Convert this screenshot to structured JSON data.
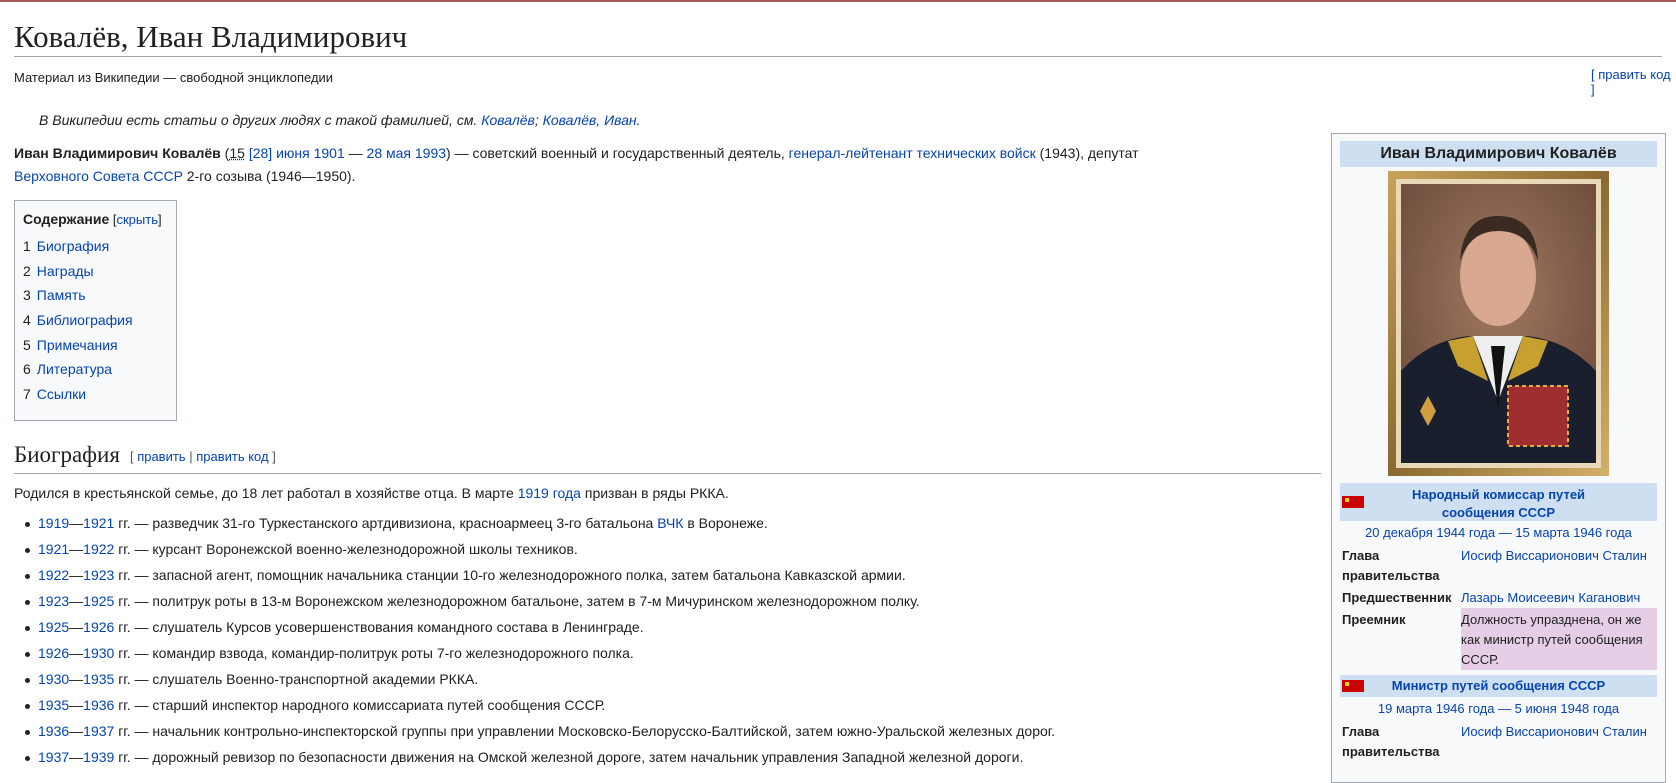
{
  "page": {
    "title": "Ковалёв, Иван Владимирович",
    "tagline": "Материал из Википедии — свободной энциклопедии",
    "edit_code": "[ править код ]"
  },
  "hatnote": {
    "prefix": "В Википедии есть статьи о других людях с такой фамилией, см. ",
    "link1": "Ковалёв",
    "sep1": "; ",
    "link2": "Ковалёв, Иван",
    "suffix": "."
  },
  "lead": {
    "name": "Иван Владимирович Ковалёв",
    "open_paren": " (",
    "birth_day": "15",
    "birth_old": " [28]",
    "birth_date": " июня 1901",
    "dash": " — ",
    "death_date": "28 мая 1993",
    "mid": ") — советский военный и государственный деятель, ",
    "rank": "генерал-лейтенант технических войск",
    "rank_year": " (1943), депутат",
    "soviet": "Верховного Совета СССР",
    "end": " 2-го созыва (1946—1950)."
  },
  "toc": {
    "title": "Содержание",
    "hide": "скрыть",
    "bracket_open": " [",
    "bracket_close": "]",
    "items": [
      {
        "num": "1",
        "label": "Биография"
      },
      {
        "num": "2",
        "label": "Награды"
      },
      {
        "num": "3",
        "label": "Память"
      },
      {
        "num": "4",
        "label": "Библиография"
      },
      {
        "num": "5",
        "label": "Примечания"
      },
      {
        "num": "6",
        "label": "Литература"
      },
      {
        "num": "7",
        "label": "Ссылки"
      }
    ]
  },
  "biography": {
    "heading": "Биография",
    "edit": "править",
    "edit_code": "править код",
    "intro_pre": "Родился в крестьянской семье, до 18 лет работал в хозяйстве отца. В марте ",
    "intro_link": "1919 года",
    "intro_post": " призван в ряды РККА.",
    "items": [
      {
        "y1": "1919",
        "y2": "1921",
        "text": " гг. — разведчик 31-го Туркестанского артдивизиона, красноармеец 3-го батальона ",
        "link": "ВЧК",
        "tail": " в Воронеже."
      },
      {
        "y1": "1921",
        "y2": "1922",
        "text": " гг. — курсант Воронежской военно-железнодорожной школы техников.",
        "link": "",
        "tail": ""
      },
      {
        "y1": "1922",
        "y2": "1923",
        "text": " гг. — запасной агент, помощник начальника станции 10-го железнодорожного полка, затем батальона Кавказской армии.",
        "link": "",
        "tail": ""
      },
      {
        "y1": "1923",
        "y2": "1925",
        "text": " гг. — политрук роты в 13-м Воронежском железнодорожном батальоне, затем в 7-м Мичуринском железнодорожном полку.",
        "link": "",
        "tail": ""
      },
      {
        "y1": "1925",
        "y2": "1926",
        "text": " гг. — слушатель Курсов усовершенствования командного состава в Ленинграде.",
        "link": "",
        "tail": ""
      },
      {
        "y1": "1926",
        "y2": "1930",
        "text": " гг. — командир взвода, командир-политрук роты 7-го железнодорожного полка.",
        "link": "",
        "tail": ""
      },
      {
        "y1": "1930",
        "y2": "1935",
        "text": " гг. — слушатель Военно-транспортной академии РККА.",
        "link": "",
        "tail": ""
      },
      {
        "y1": "1935",
        "y2": "1936",
        "text": " гг. — старший инспектор народного комиссариата путей сообщения СССР.",
        "link": "",
        "tail": ""
      },
      {
        "y1": "1936",
        "y2": "1937",
        "text": " гг. — начальник контрольно-инспекторской группы при управлении Московско-Белорусско-Балтийской, затем южно-Уральской железных дорог.",
        "link": "",
        "tail": ""
      },
      {
        "y1": "1937",
        "y2": "1939",
        "text": " гг. — дорожный ревизор по безопасности движения на Омской железной дороге, затем начальник управления Западной железной дороги.",
        "link": "",
        "tail": ""
      }
    ]
  },
  "infobox": {
    "title": "Иван Владимирович Ковалёв",
    "section1": {
      "title": "Народный комиссар путей сообщения СССР",
      "dates": "20 декабря 1944 года — 15 марта 1946 года",
      "rows": [
        {
          "label": "Глава правительства",
          "value": "Иосиф Виссарионович Сталин",
          "style": "link"
        },
        {
          "label": "Предшественник",
          "value": "Лазарь Моисеевич Каганович",
          "style": "link"
        },
        {
          "label": "Преемник",
          "value": "Должность упразднена, он же как министр путей сообщения СССР.",
          "style": "pink"
        }
      ]
    },
    "section2": {
      "title": "Министр путей сообщения СССР",
      "dates": "19 марта 1946 года — 5 июня 1948 года",
      "rows": [
        {
          "label": "Глава правительства",
          "value": "Иосиф Виссарионович Сталин",
          "style": "link"
        }
      ]
    },
    "colors": {
      "header_bg": "#cedff2",
      "flag": "#cc0000",
      "pink": "#e6cfe6",
      "link": "#0645ad"
    }
  }
}
